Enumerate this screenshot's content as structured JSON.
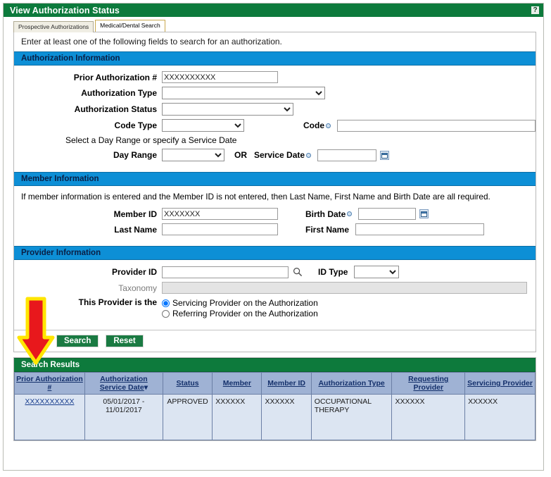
{
  "window": {
    "title": "View Authorization Status",
    "help_icon": "help-question-icon"
  },
  "tabs": [
    {
      "label": "Prospective Authorizations",
      "active": false
    },
    {
      "label": "Medical/Dental Search",
      "active": true
    }
  ],
  "intro": "Enter at least one of the following fields to search for an authorization.",
  "sections": {
    "authorization": {
      "header": "Authorization Information",
      "prior_auth_label": "Prior Authorization #",
      "prior_auth_value": "XXXXXXXXXX",
      "auth_type_label": "Authorization Type",
      "auth_type_value": "",
      "auth_status_label": "Authorization Status",
      "auth_status_value": "",
      "code_type_label": "Code Type",
      "code_type_value": "",
      "code_label": "Code",
      "code_value": "",
      "day_range_note": "Select a Day Range or specify a Service Date",
      "day_range_label": "Day Range",
      "day_range_value": "",
      "or_label": "OR",
      "service_date_label": "Service Date",
      "service_date_value": "",
      "calendar_icon": "calendar-icon"
    },
    "member": {
      "header": "Member Information",
      "note": "If member information is entered and the Member ID is not entered, then Last Name, First Name and Birth Date are all required.",
      "member_id_label": "Member ID",
      "member_id_value": "XXXXXXX",
      "birth_date_label": "Birth Date",
      "birth_date_value": "",
      "last_name_label": "Last Name",
      "last_name_value": "",
      "first_name_label": "First Name",
      "first_name_value": "",
      "calendar_icon": "calendar-icon"
    },
    "provider": {
      "header": "Provider Information",
      "provider_id_label": "Provider ID",
      "provider_id_value": "",
      "search_icon": "magnifier-icon",
      "id_type_label": "ID Type",
      "id_type_value": "",
      "taxonomy_label": "Taxonomy",
      "taxonomy_value": "",
      "this_provider_label": "This Provider is the",
      "radio_servicing": "Servicing Provider on the Authorization",
      "radio_referring": "Referring Provider on the Authorization",
      "selected_radio": "servicing"
    }
  },
  "buttons": {
    "search": "Search",
    "reset": "Reset"
  },
  "results": {
    "header": "Search Results",
    "columns": [
      "Prior Authorization #",
      "Authorization Service Date",
      "Status",
      "Member",
      "Member ID",
      "Authorization Type",
      "Requesting Provider",
      "Servicing Provider"
    ],
    "sorted_column": "Authorization Service Date",
    "sort_indicator": "▾",
    "rows": [
      {
        "prior_authorization": "XXXXXXXXXX",
        "service_date": "05/01/2017 - 11/01/2017",
        "status": "APPROVED",
        "member": "XXXXXX",
        "member_id": "XXXXXX",
        "authorization_type": "OCCUPATIONAL THERAPY",
        "requesting_provider": "XXXXXX",
        "servicing_provider": "XXXXXX"
      }
    ]
  },
  "annotation": {
    "arrow": "red-down-arrow-annotation",
    "fill": "#e8181c",
    "outline": "#ffe500"
  }
}
